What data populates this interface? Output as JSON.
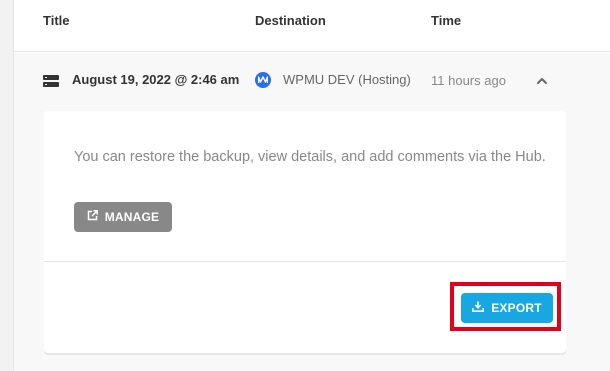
{
  "table": {
    "columns": {
      "title": "Title",
      "destination": "Destination",
      "time": "Time"
    }
  },
  "row": {
    "title": "August 19, 2022 @ 2:46 am",
    "destination": "WPMU DEV (Hosting)",
    "time": "11 hours ago",
    "icons": {
      "row": "server-icon",
      "destination": "wpmudev-logo-icon",
      "toggle": "chevron-up-icon"
    }
  },
  "details": {
    "description": "You can restore the backup, view details, and add comments via the Hub.",
    "manage_label": "MANAGE",
    "manage_icon": "external-link-icon",
    "export_label": "EXPORT",
    "export_icon": "download-icon"
  },
  "colors": {
    "export_button": "#17a8e3",
    "manage_button": "#888888",
    "destination_logo": "#286ef1",
    "highlight_box": "#e3001b"
  }
}
